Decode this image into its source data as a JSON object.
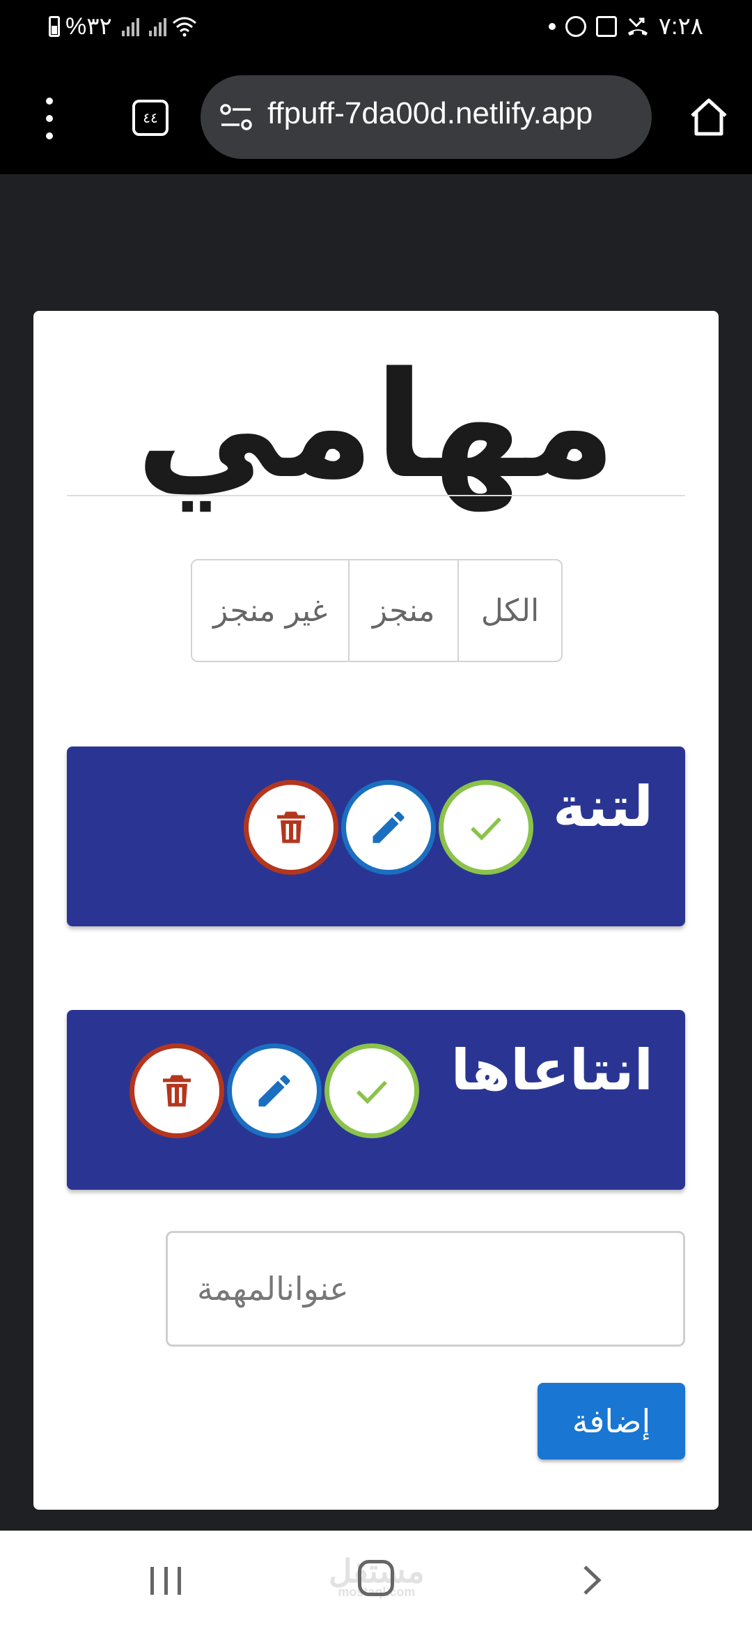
{
  "status_bar": {
    "battery": "%٣٢",
    "time": "٧:٢٨"
  },
  "browser": {
    "url": "ffpuff-7da00d.netlify.app",
    "tab_count": "٤٤"
  },
  "app": {
    "title": "مهامي",
    "filters": [
      {
        "label": "الكل"
      },
      {
        "label": "منجز"
      },
      {
        "label": "غير منجز"
      }
    ],
    "tasks": [
      {
        "title": "لتنة"
      },
      {
        "title": "انتاعاها"
      }
    ],
    "input": {
      "placeholder": "عنوانالمهمة",
      "value": ""
    },
    "add_button_label": "إضافة"
  },
  "watermark": {
    "line1": "مستقل",
    "line2": "mostaql.com"
  },
  "colors": {
    "task_bg": "#2a3593",
    "delete": "#b3361d",
    "edit": "#1a6fc0",
    "done": "#8bc34a",
    "primary": "#1976d2"
  }
}
